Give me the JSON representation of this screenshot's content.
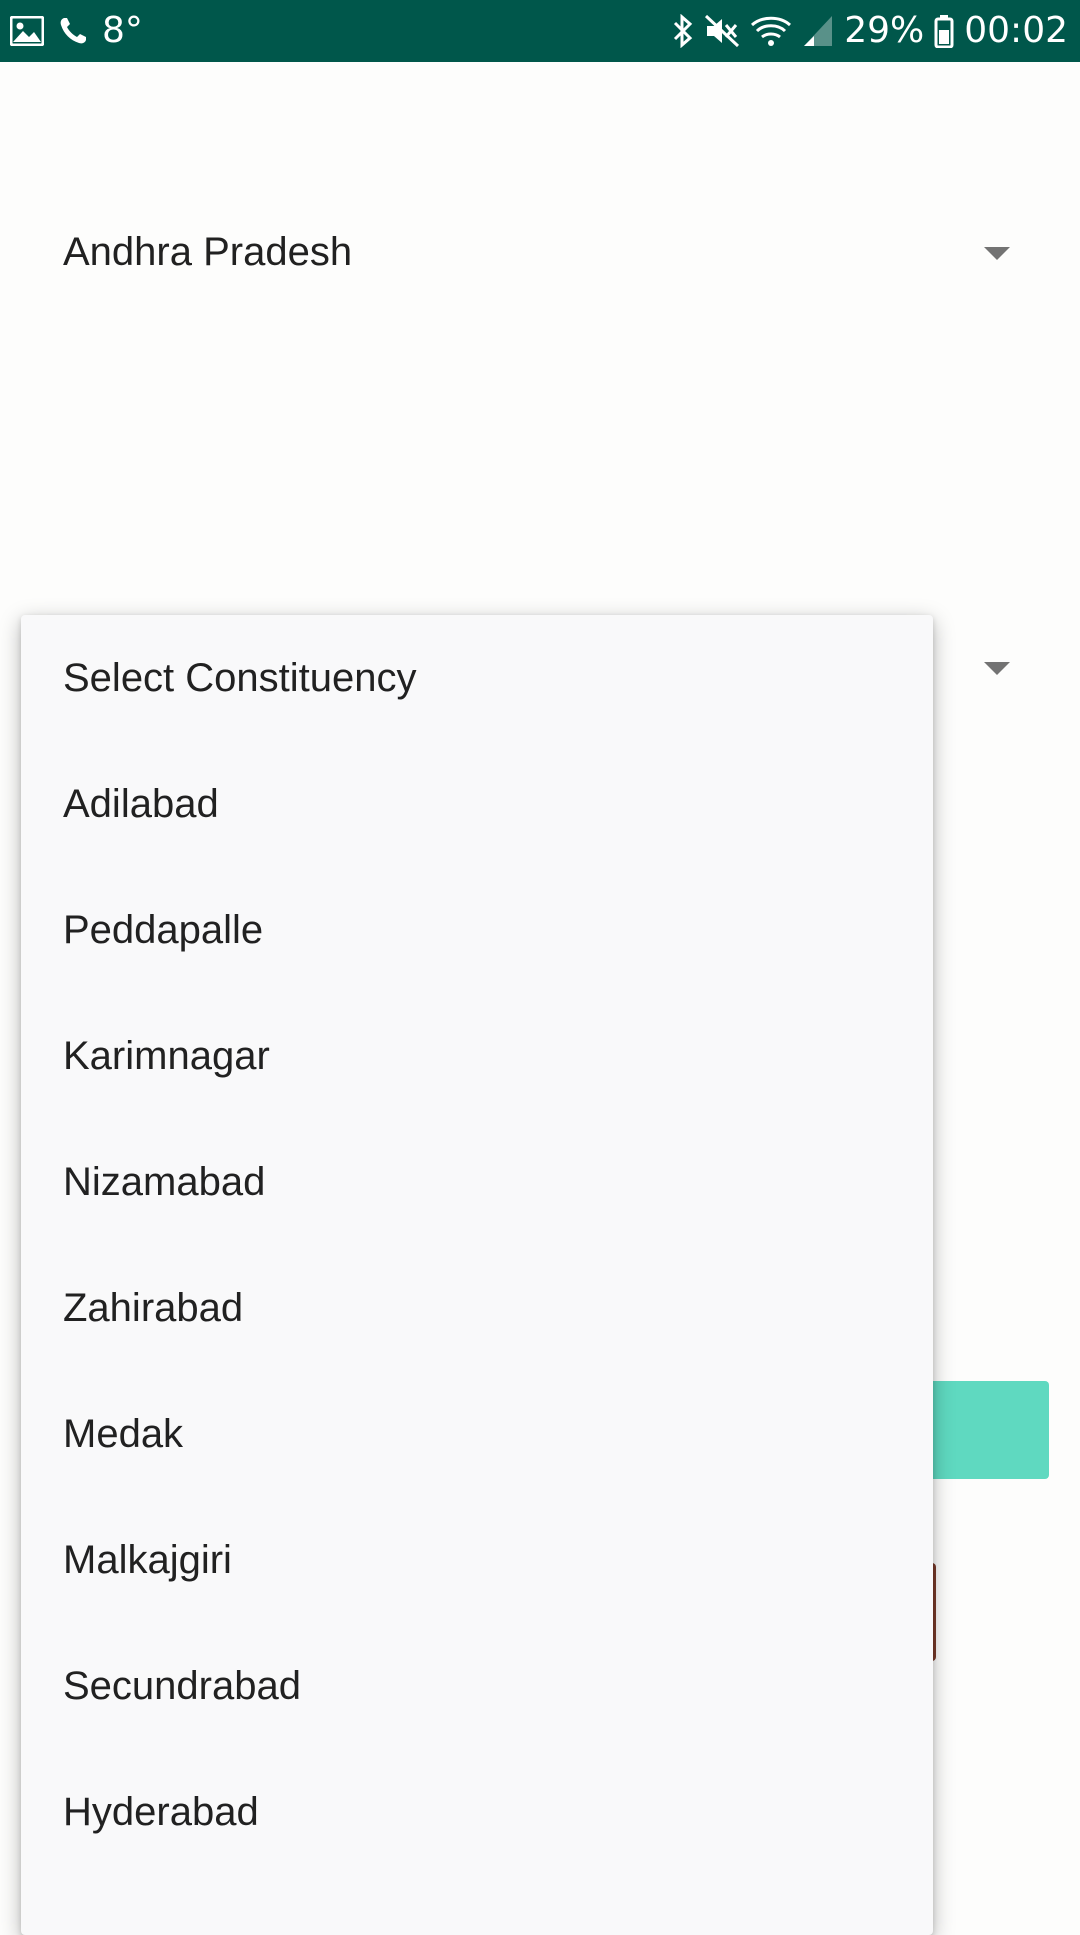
{
  "status_bar": {
    "left_icons": [
      "image-icon",
      "phone-icon"
    ],
    "temperature": "8°",
    "right_icons": [
      "bluetooth-icon",
      "mute-icon",
      "wifi-icon",
      "signal-icon",
      "battery-icon"
    ],
    "battery_percent": "29%",
    "time": "00:02",
    "background_color": "#00574b"
  },
  "state_spinner": {
    "selected_value": "Andhra Pradesh"
  },
  "constituency_dropdown": {
    "items": [
      "Select Constituency",
      "Adilabad",
      "Peddapalle",
      "Karimnagar",
      "Nizamabad",
      "Zahirabad",
      "Medak",
      "Malkajgiri",
      "Secundrabad",
      "Hyderabad"
    ]
  },
  "colors": {
    "accent_button": "#5fd9c0",
    "secondary_button": "#7a3b2a",
    "dropdown_background": "#f9f9fa"
  }
}
